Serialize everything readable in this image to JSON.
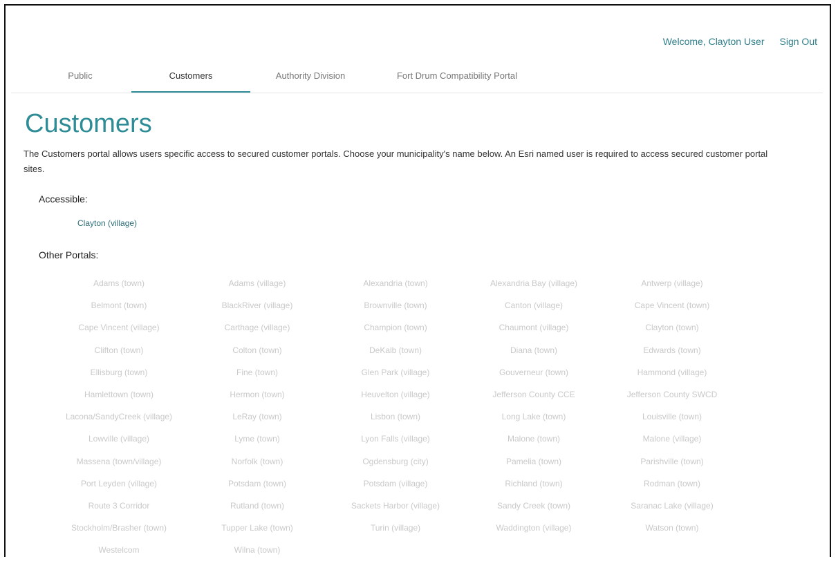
{
  "header": {
    "welcome": "Welcome, Clayton User",
    "sign_out": "Sign Out"
  },
  "tabs": [
    {
      "label": "Public"
    },
    {
      "label": "Customers"
    },
    {
      "label": "Authority Division"
    },
    {
      "label": "Fort Drum Compatibility Portal"
    }
  ],
  "page": {
    "title": "Customers",
    "description": "The Customers portal allows users specific access to secured customer portals. Choose your municipality's name below. An Esri named user is required to access secured customer portal sites.",
    "accessible_label": "Accessible:",
    "accessible_items": [
      "Clayton (village)"
    ],
    "other_label": "Other Portals:"
  },
  "portals": [
    "Adams (town)",
    "Adams (village)",
    "Alexandria (town)",
    "Alexandria Bay (village)",
    "Antwerp (village)",
    "Belmont (town)",
    "BlackRiver (village)",
    "Brownville (town)",
    "Canton (village)",
    "Cape Vincent (town)",
    "Cape Vincent (village)",
    "Carthage (village)",
    "Champion (town)",
    "Chaumont (village)",
    "Clayton (town)",
    "Clifton (town)",
    "Colton (town)",
    "DeKalb (town)",
    "Diana (town)",
    "Edwards (town)",
    "Ellisburg (town)",
    "Fine (town)",
    "Glen Park (village)",
    "Gouverneur (town)",
    "Hammond (village)",
    "Hamlettown (town)",
    "Hermon (town)",
    "Heuvelton (village)",
    "Jefferson County CCE",
    "Jefferson County SWCD",
    "Lacona/SandyCreek (village)",
    "LeRay (town)",
    "Lisbon (town)",
    "Long Lake (town)",
    "Louisville (town)",
    "Lowville (village)",
    "Lyme (town)",
    "Lyon Falls (village)",
    "Malone (town)",
    "Malone (village)",
    "Massena (town/village)",
    "Norfolk (town)",
    "Ogdensburg (city)",
    "Pamelia (town)",
    "Parishville (town)",
    "Port Leyden (village)",
    "Potsdam (town)",
    "Potsdam (village)",
    "Richland (town)",
    "Rodman (town)",
    "Route 3 Corridor",
    "Rutland (town)",
    "Sackets Harbor (village)",
    "Sandy Creek (town)",
    "Saranac Lake (village)",
    "Stockholm/Brasher (town)",
    "Tupper Lake (town)",
    "Turin (village)",
    "Waddington (village)",
    "Watson (town)",
    "Westelcom",
    "Wilna (town)"
  ],
  "colors": {
    "accent": "#2e8c96",
    "link": "#2e6b75",
    "disabled_text": "#c9c9c9"
  }
}
